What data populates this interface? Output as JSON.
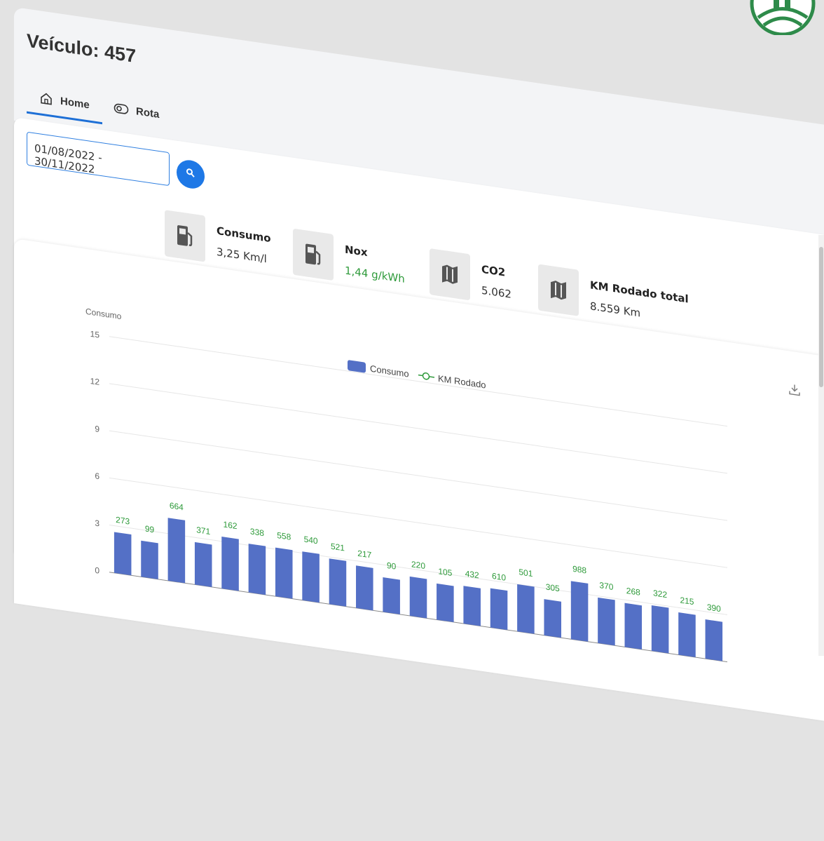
{
  "header": {
    "title": "Veículo: 457",
    "tabs": [
      {
        "label": "Home",
        "icon": "home-icon",
        "active": true
      },
      {
        "label": "Rota",
        "icon": "route-icon",
        "active": false
      }
    ]
  },
  "filter": {
    "date_range": "01/08/2022 - 30/11/2022",
    "search_icon": "search-icon"
  },
  "metrics": [
    {
      "label": "Consumo",
      "value": "3,25 Km/l",
      "icon": "fuel-pump-icon"
    },
    {
      "label": "Nox",
      "value": "1,44 g/kWh",
      "icon": "fuel-pump-icon",
      "value_color": "#2e9a3a"
    },
    {
      "label": "CO2",
      "value": "5.062",
      "icon": "map-icon"
    },
    {
      "label": "KM Rodado total",
      "value": "8.559 Km",
      "icon": "map-icon"
    }
  ],
  "chart_data": {
    "type": "bar",
    "ylabel": "Consumo",
    "yticks": [
      0,
      3,
      6,
      9,
      12,
      15
    ],
    "ylim": [
      0,
      15
    ],
    "legend": [
      "Consumo",
      "KM Rodado"
    ],
    "legend_placement": "top-center",
    "series": [
      {
        "name": "Consumo",
        "type": "bar",
        "color": "#5470c6",
        "values": [
          2.6,
          2.3,
          4.0,
          2.7,
          3.3,
          3.1,
          3.1,
          3.1,
          2.9,
          2.7,
          2.2,
          2.5,
          2.3,
          2.4,
          2.5,
          3.0,
          2.3,
          3.7,
          2.9,
          2.8,
          2.9,
          2.7,
          2.5
        ]
      },
      {
        "name": "KM Rodado",
        "type": "line",
        "color": "#2e9a3a",
        "labels": [
          273,
          99,
          664,
          371,
          162,
          338,
          558,
          540,
          521,
          217,
          90,
          220,
          105,
          432,
          610,
          501,
          305,
          988,
          370,
          268,
          322,
          215,
          390
        ]
      }
    ]
  },
  "colors": {
    "accent": "#1e78e6",
    "bar": "#5470c6",
    "km_label": "#2e9a3a",
    "logo": "#2e8b4a"
  },
  "icons": {
    "download": "download-icon",
    "logo": "logo-icon"
  }
}
